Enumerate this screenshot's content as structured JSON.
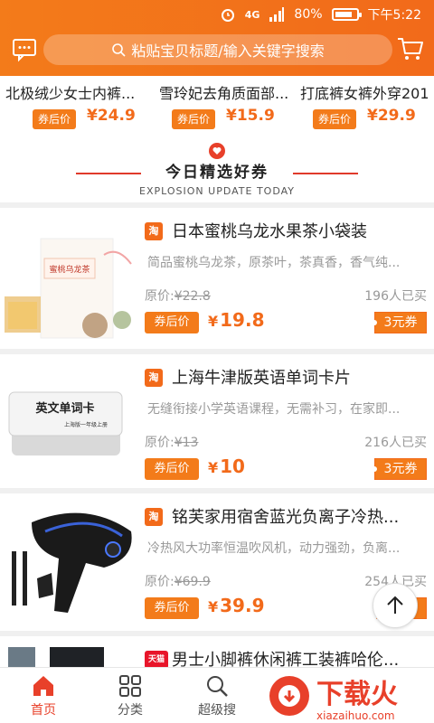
{
  "status": {
    "network": "4G",
    "battery": "80%",
    "time": "下午5:22"
  },
  "header": {
    "search_placeholder": "粘贴宝贝标题/输入关键字搜索"
  },
  "top_strip": [
    {
      "title": "北极绒少女士内裤...",
      "coupon_label": "券后价",
      "price": "¥24.9"
    },
    {
      "title": "雪玲妃去角质面部...",
      "coupon_label": "券后价",
      "price": "¥15.9"
    },
    {
      "title": "打底裤女裤外穿201",
      "coupon_label": "券后价",
      "price": "¥29.9"
    }
  ],
  "section": {
    "title": "今日精选好券",
    "subtitle": "EXPLOSION UPDATE TODAY"
  },
  "products": [
    {
      "badge": "淘",
      "title": "日本蜜桃乌龙水果茶小袋装",
      "desc": "简品蜜桃乌龙茶，原茶叶，茶真香，香气纯...",
      "orig_label": "原价:",
      "orig_price": "¥22.8",
      "sold": "196人已买",
      "coupon_label": "券后价",
      "price_yen": "¥",
      "price": "19.8",
      "coupon": "3元券",
      "img_text": "蜜桃乌龙茶"
    },
    {
      "badge": "淘",
      "title": "上海牛津版英语单词卡片",
      "desc": "无缝衔接小学英语课程，无需补习，在家即...",
      "orig_label": "原价:",
      "orig_price": "¥13",
      "sold": "216人已买",
      "coupon_label": "券后价",
      "price_yen": "¥",
      "price": "10",
      "coupon": "3元券",
      "img_text": "英文单词卡",
      "img_subtext": "上海版一年级上册"
    },
    {
      "badge": "淘",
      "title": "铭芙家用宿舍蓝光负离子冷热...",
      "desc": "冷热风大功率恒温吹风机，动力强劲，负离...",
      "orig_label": "原价:",
      "orig_price": "¥69.9",
      "sold": "254人已买",
      "coupon_label": "券后价",
      "price_yen": "¥",
      "price": "39.9",
      "coupon": "",
      "img_text": ""
    },
    {
      "badge": "天猫",
      "title": "男士小脚裤休闲裤工装裤哈伦...",
      "desc": "",
      "orig_label": "",
      "orig_price": "",
      "sold": "",
      "coupon_label": "",
      "price_yen": "",
      "price": "",
      "coupon": "",
      "img_text": ""
    }
  ],
  "tabs": [
    {
      "label": "首页",
      "icon": "home-icon"
    },
    {
      "label": "分类",
      "icon": "grid-icon"
    },
    {
      "label": "超级搜",
      "icon": "search-icon"
    }
  ],
  "watermark": {
    "text": "下载火",
    "url": "xiazaihuo.com"
  },
  "colors": {
    "brand": "#f26a1a",
    "accent_red": "#e8402a"
  }
}
